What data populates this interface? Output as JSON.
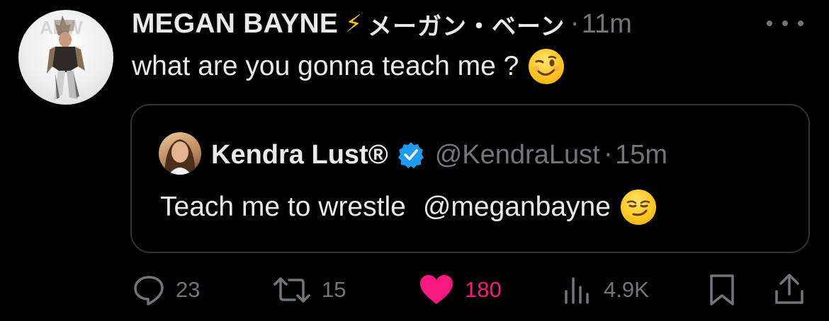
{
  "author": {
    "display_name": "MEGAN BAYNE",
    "badge_icon": "lightning-bolt-emoji",
    "name_suffix": "メーガン・ベーン",
    "separator": "·",
    "timestamp": "11m",
    "avatar_logo_text": "AEW"
  },
  "tweet": {
    "text": "what are you gonna teach me ?",
    "emoji": "winking-face-emoji"
  },
  "quoted_tweet": {
    "display_name": "Kendra Lust®",
    "verified_icon": "verified-badge-icon",
    "handle": "@KendraLust",
    "separator": "·",
    "timestamp": "15m",
    "text": "Teach me to wrestle",
    "mention": "@meganbayne",
    "emoji": "smirking-face-emoji"
  },
  "actions": {
    "replies": "23",
    "retweets": "15",
    "likes": "180",
    "views": "4.9K"
  },
  "colors": {
    "background": "#000000",
    "text_primary": "#e7e9ea",
    "text_secondary": "#71767b",
    "like_pink": "#f91880",
    "verified_blue": "#1d9bf0",
    "border": "#2f3336"
  }
}
